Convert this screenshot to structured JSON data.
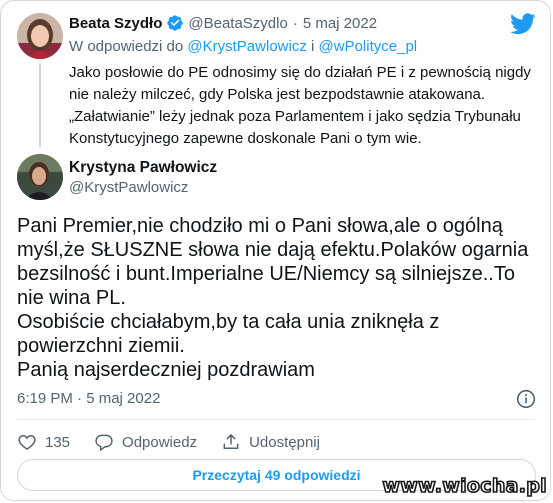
{
  "quoted_tweet": {
    "author_name": "Beata Szydło",
    "author_handle": "@BeataSzydlo",
    "separator": "·",
    "date": "5 maj 2022",
    "reply_prefix": "W odpowiedzi do",
    "reply_user_1": "@KrystPawlowicz",
    "reply_conjunction": "i",
    "reply_user_2": "@wPolityce_pl",
    "text_lines": [
      "Jako posłowie do PE odnosimy się do działań PE i z pewnością nigdy",
      "nie należy milczeć, gdy Polska jest bezpodstawnie atakowana.",
      "„Załatwianie” leży jednak poza Parlamentem i jako sędzia Trybunału",
      "Konstytucyjnego zapewne doskonale Pani o tym wie."
    ]
  },
  "main_tweet": {
    "author_name": "Krystyna Pawłowicz",
    "author_handle": "@KrystPawlowicz",
    "text_lines": [
      "Pani Premier,nie chodziło mi o Pani słowa,ale o ogólną",
      "myśl,że SŁUSZNE słowa nie dają efektu.Polaków ogarnia",
      "bezsilność i bunt.Imperialne UE/Niemcy są silniejsze..To",
      "nie wina PL.",
      "Osobiście chciałabym,by ta cała unia zniknęła z",
      "powierzchni ziemii.",
      "Panią najserdeczniej pozdrawiam"
    ],
    "timestamp": "6:19 PM · 5 maj 2022"
  },
  "actions": {
    "likes_count": "135",
    "reply_label": "Odpowiedz",
    "share_label": "Udostępnij"
  },
  "read_more": "Przeczytaj 49 odpowiedzi",
  "watermark": "www.wiocha.pl",
  "colors": {
    "accent": "#1d9bf0",
    "text": "#0f1419",
    "muted": "#536471",
    "border": "#cfd9de"
  }
}
